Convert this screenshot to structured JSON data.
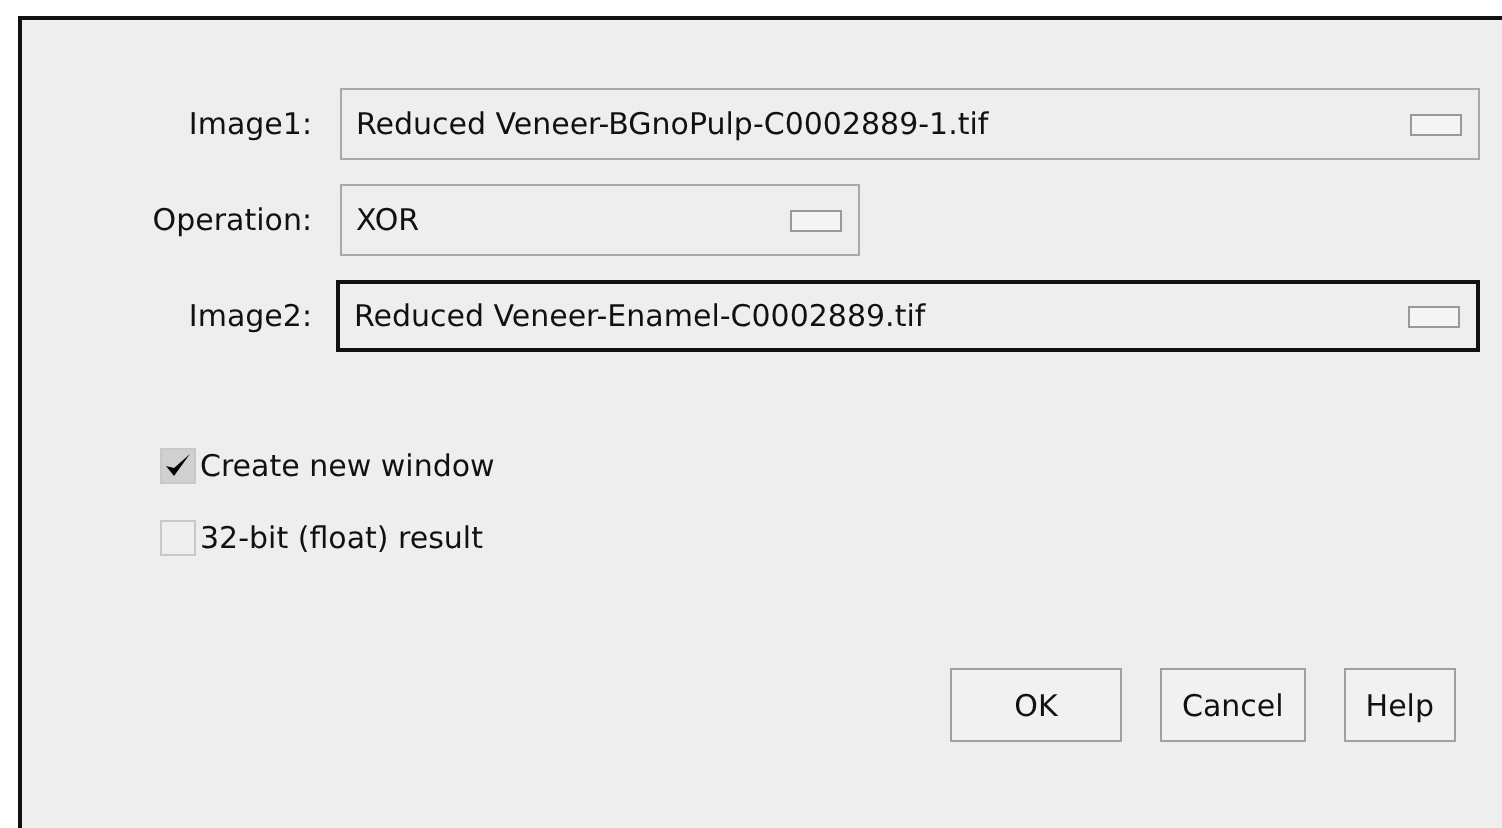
{
  "choices": [
    {
      "label": "Image1:",
      "value": "Reduced Veneer-BGnoPulp-C0002889-1.tif",
      "wide": true,
      "focused": false
    },
    {
      "label": "Operation:",
      "value": "XOR",
      "wide": false,
      "focused": false
    },
    {
      "label": "Image2:",
      "value": "Reduced Veneer-Enamel-C0002889.tif",
      "wide": true,
      "focused": true
    }
  ],
  "checkboxes": [
    {
      "label": "Create new window",
      "checked": true
    },
    {
      "label": "32-bit (float) result",
      "checked": false
    }
  ],
  "buttons": [
    "OK",
    "Cancel",
    "Help"
  ]
}
